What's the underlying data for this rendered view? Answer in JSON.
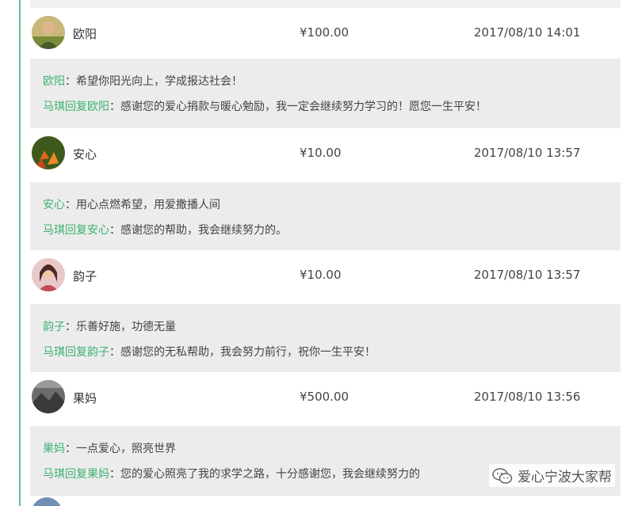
{
  "donations": [
    {
      "avatar_icon": "avatar-man-photo",
      "name": "欧阳",
      "amount": "¥100.00",
      "time": "2017/08/10 14:01",
      "message_author": "欧阳",
      "message_sep": "：",
      "message_text": "希望你阳光向上，学成报达社会！",
      "reply_author": "马琪",
      "reply_word": "回复",
      "reply_target": "欧阳",
      "reply_sep": "：",
      "reply_text": "感谢您的爱心捐款与暖心勉励，我一定会继续努力学习的！愿您一生平安！"
    },
    {
      "avatar_icon": "avatar-autumn-leaves",
      "name": "安心",
      "amount": "¥10.00",
      "time": "2017/08/10 13:57",
      "message_author": "安心",
      "message_sep": "：",
      "message_text": "用心点燃希望，用爱撒播人间",
      "reply_author": "马琪",
      "reply_word": "回复",
      "reply_target": "安心",
      "reply_sep": "：",
      "reply_text": "感谢您的帮助，我会继续努力的。"
    },
    {
      "avatar_icon": "avatar-woman-photo",
      "name": "韵子",
      "amount": "¥10.00",
      "time": "2017/08/10 13:57",
      "message_author": "韵子",
      "message_sep": "：",
      "message_text": "乐善好施，功德无量",
      "reply_author": "马琪",
      "reply_word": "回复",
      "reply_target": "韵子",
      "reply_sep": "：",
      "reply_text": "感谢您的无私帮助，我会努力前行，祝你一生平安！"
    },
    {
      "avatar_icon": "avatar-landscape-photo",
      "name": "果妈",
      "amount": "¥500.00",
      "time": "2017/08/10 13:56",
      "message_author": "果妈",
      "message_sep": "：",
      "message_text": "一点爱心，照亮世界",
      "reply_author": "马琪",
      "reply_word": "回复",
      "reply_target": "果妈",
      "reply_sep": "：",
      "reply_text": "您的爱心照亮了我的求学之路，十分感谢您，我会继续努力的"
    }
  ],
  "watermark": {
    "icon": "wechat-icon",
    "text": "爱心宁波大家帮"
  },
  "colors": {
    "accent_green": "#3bb272",
    "message_bg": "#ececec",
    "side_rule": "#5cc08a"
  }
}
